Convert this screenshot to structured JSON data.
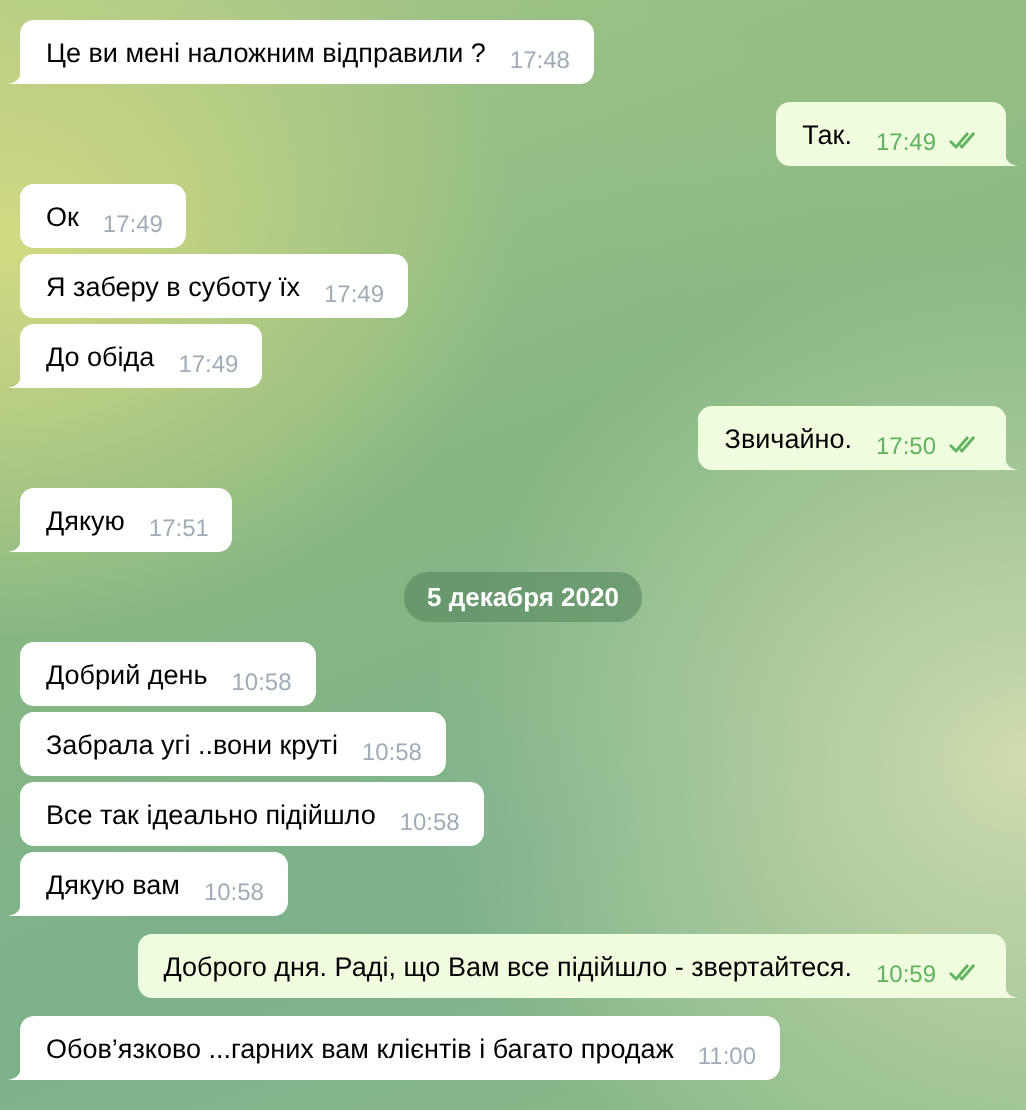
{
  "messages": [
    {
      "kind": "incoming",
      "text": "Це ви мені наложним відправили ?",
      "time": "17:48"
    },
    {
      "kind": "outgoing",
      "text": "Так.",
      "time": "17:49",
      "read": true
    },
    {
      "kind": "incoming",
      "text": "Ок",
      "time": "17:49"
    },
    {
      "kind": "incoming",
      "text": "Я заберу в суботу їх",
      "time": "17:49"
    },
    {
      "kind": "incoming",
      "text": "До обіда",
      "time": "17:49"
    },
    {
      "kind": "outgoing",
      "text": "Звичайно.",
      "time": "17:50",
      "read": true
    },
    {
      "kind": "incoming",
      "text": "Дякую",
      "time": "17:51"
    },
    {
      "kind": "date",
      "text": "5 декабря 2020"
    },
    {
      "kind": "incoming",
      "text": "Добрий день",
      "time": "10:58"
    },
    {
      "kind": "incoming",
      "text": "Забрала угі ..вони круті",
      "time": "10:58"
    },
    {
      "kind": "incoming",
      "text": "Все так ідеально підійшло",
      "time": "10:58"
    },
    {
      "kind": "incoming",
      "text": "Дякую вам",
      "time": "10:58"
    },
    {
      "kind": "outgoing",
      "text": "Доброго дня. Раді, що Вам все підійшло - звертайтеся.",
      "time": "10:59",
      "read": true
    },
    {
      "kind": "incoming",
      "text": "Обов’язково ...гарних вам клієнтів і багато продаж",
      "time": "11:00"
    }
  ]
}
